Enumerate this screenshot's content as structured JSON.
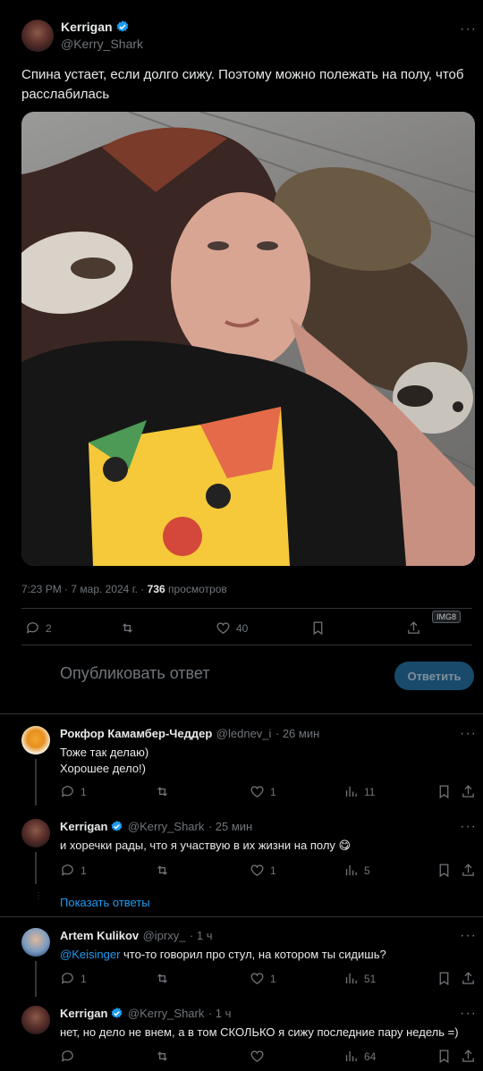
{
  "post": {
    "author": {
      "name": "Kerrigan",
      "handle": "@Kerry_Shark"
    },
    "text": "Спина устает, если долго сижу. Поэтому можно полежать на полу, чтоб расслабилась",
    "meta": {
      "time": "7:23 PM",
      "date": "7 мар. 2024 г.",
      "sep": "·",
      "views_count": "736",
      "views_label": "просмотров"
    },
    "actions": {
      "replies": "2",
      "likes": "40",
      "badge": "IMG8"
    }
  },
  "reply_box": {
    "placeholder": "Опубликовать ответ",
    "button": "Ответить"
  },
  "replies": [
    {
      "name": "Рокфор Камамбер-Чеддер",
      "handle": "@lednev_i",
      "time": "· 26 мин",
      "lines": [
        "Тоже так делаю)",
        "Хорошее дело!)"
      ],
      "replies": "1",
      "likes": "1",
      "views": "11"
    },
    {
      "name": "Kerrigan",
      "handle": "@Kerry_Shark",
      "time": "· 25 мин",
      "lines": [
        "и хоречки рады, что я участвую в их жизни на полу 😋"
      ],
      "replies": "1",
      "likes": "1",
      "views": "5"
    },
    {
      "name": "Artem Kulikov",
      "handle": "@iprxy_",
      "time": "· 1 ч",
      "mention": "@Keisinger",
      "text": " что-то говорил про стул, на котором ты сидишь?",
      "replies": "1",
      "likes": "1",
      "views": "51"
    },
    {
      "name": "Kerrigan",
      "handle": "@Kerry_Shark",
      "time": "· 1 ч",
      "lines": [
        "нет, но дело не внем, а в том СКОЛЬКО я сижу последние пару недель =)"
      ],
      "replies": "",
      "likes": "",
      "views": "64"
    }
  ],
  "show_replies": "Показать ответы",
  "colors": {
    "accent": "#1d9bf0",
    "button_bg": "#1a4a6b",
    "muted": "#71767b",
    "divider": "#2f3336"
  }
}
